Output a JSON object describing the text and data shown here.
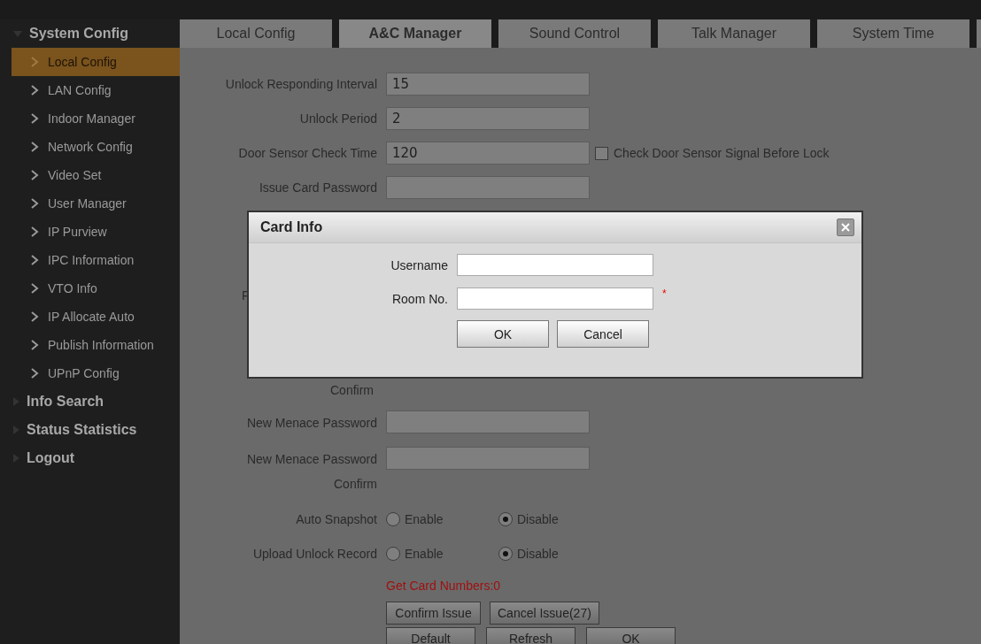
{
  "sidebar": [
    {
      "label": "System Config",
      "expanded": true,
      "children": [
        {
          "label": "Local Config",
          "selected": true
        },
        {
          "label": "LAN Config",
          "selected": false
        },
        {
          "label": "Indoor Manager",
          "selected": false
        },
        {
          "label": "Network Config",
          "selected": false
        },
        {
          "label": "Video Set",
          "selected": false
        },
        {
          "label": "User Manager",
          "selected": false
        },
        {
          "label": "IP Purview",
          "selected": false
        },
        {
          "label": "IPC Information",
          "selected": false
        },
        {
          "label": "VTO Info",
          "selected": false
        },
        {
          "label": "IP Allocate Auto",
          "selected": false
        },
        {
          "label": "Publish Information",
          "selected": false
        },
        {
          "label": "UPnP Config",
          "selected": false
        }
      ]
    },
    {
      "label": "Info Search",
      "expanded": false
    },
    {
      "label": "Status Statistics",
      "expanded": false
    },
    {
      "label": "Logout",
      "expanded": false
    }
  ],
  "tabs": [
    {
      "label": "Local Config",
      "selected": false
    },
    {
      "label": "A&C Manager",
      "selected": true
    },
    {
      "label": "Sound Control",
      "selected": false
    },
    {
      "label": "Talk Manager",
      "selected": false
    },
    {
      "label": "System Time",
      "selected": false
    }
  ],
  "form": {
    "fields": [
      {
        "label": "Unlock Responding Interval",
        "value": "15"
      },
      {
        "label": "Unlock Period",
        "value": "2"
      },
      {
        "label": "Door Sensor Check Time",
        "value": "120",
        "checkbox": {
          "label": "Check Door Sensor Signal Before Lock",
          "checked": false
        }
      },
      {
        "label": "Issue Card Password"
      }
    ],
    "obscured": {
      "fragment": "F",
      "confirm": "Confirm"
    },
    "menace_fields": [
      {
        "lines": [
          "New Menace Password"
        ]
      },
      {
        "lines": [
          "New Menace Password",
          "Confirm"
        ]
      }
    ],
    "radio_groups": [
      {
        "label": "Auto Snapshot",
        "options": [
          {
            "label": "Enable",
            "selected": false
          },
          {
            "label": "Disable",
            "selected": true
          }
        ]
      },
      {
        "label": "Upload Unlock Record",
        "options": [
          {
            "label": "Enable",
            "selected": false
          },
          {
            "label": "Disable",
            "selected": true
          }
        ]
      }
    ],
    "card_count": "Get Card Numbers:0",
    "issue_buttons": [
      "Confirm Issue",
      "Cancel Issue(27)"
    ],
    "buttons": [
      "Default",
      "Refresh",
      "OK"
    ]
  },
  "dialog": {
    "title": "Card Info",
    "required_mark": "*",
    "fields": [
      {
        "label": "Username",
        "required": false
      },
      {
        "label": "Room No.",
        "required": true
      }
    ],
    "buttons": [
      "OK",
      "Cancel"
    ]
  }
}
